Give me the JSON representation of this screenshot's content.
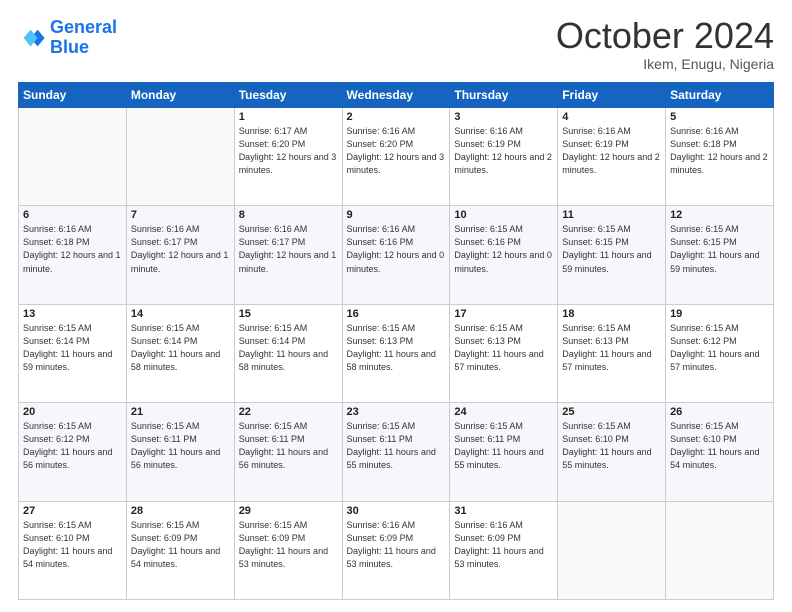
{
  "header": {
    "logo_general": "General",
    "logo_blue": "Blue",
    "month": "October 2024",
    "location": "Ikem, Enugu, Nigeria"
  },
  "days_of_week": [
    "Sunday",
    "Monday",
    "Tuesday",
    "Wednesday",
    "Thursday",
    "Friday",
    "Saturday"
  ],
  "weeks": [
    [
      {
        "day": "",
        "info": ""
      },
      {
        "day": "",
        "info": ""
      },
      {
        "day": "1",
        "info": "Sunrise: 6:17 AM\nSunset: 6:20 PM\nDaylight: 12 hours and 3 minutes."
      },
      {
        "day": "2",
        "info": "Sunrise: 6:16 AM\nSunset: 6:20 PM\nDaylight: 12 hours and 3 minutes."
      },
      {
        "day": "3",
        "info": "Sunrise: 6:16 AM\nSunset: 6:19 PM\nDaylight: 12 hours and 2 minutes."
      },
      {
        "day": "4",
        "info": "Sunrise: 6:16 AM\nSunset: 6:19 PM\nDaylight: 12 hours and 2 minutes."
      },
      {
        "day": "5",
        "info": "Sunrise: 6:16 AM\nSunset: 6:18 PM\nDaylight: 12 hours and 2 minutes."
      }
    ],
    [
      {
        "day": "6",
        "info": "Sunrise: 6:16 AM\nSunset: 6:18 PM\nDaylight: 12 hours and 1 minute."
      },
      {
        "day": "7",
        "info": "Sunrise: 6:16 AM\nSunset: 6:17 PM\nDaylight: 12 hours and 1 minute."
      },
      {
        "day": "8",
        "info": "Sunrise: 6:16 AM\nSunset: 6:17 PM\nDaylight: 12 hours and 1 minute."
      },
      {
        "day": "9",
        "info": "Sunrise: 6:16 AM\nSunset: 6:16 PM\nDaylight: 12 hours and 0 minutes."
      },
      {
        "day": "10",
        "info": "Sunrise: 6:15 AM\nSunset: 6:16 PM\nDaylight: 12 hours and 0 minutes."
      },
      {
        "day": "11",
        "info": "Sunrise: 6:15 AM\nSunset: 6:15 PM\nDaylight: 11 hours and 59 minutes."
      },
      {
        "day": "12",
        "info": "Sunrise: 6:15 AM\nSunset: 6:15 PM\nDaylight: 11 hours and 59 minutes."
      }
    ],
    [
      {
        "day": "13",
        "info": "Sunrise: 6:15 AM\nSunset: 6:14 PM\nDaylight: 11 hours and 59 minutes."
      },
      {
        "day": "14",
        "info": "Sunrise: 6:15 AM\nSunset: 6:14 PM\nDaylight: 11 hours and 58 minutes."
      },
      {
        "day": "15",
        "info": "Sunrise: 6:15 AM\nSunset: 6:14 PM\nDaylight: 11 hours and 58 minutes."
      },
      {
        "day": "16",
        "info": "Sunrise: 6:15 AM\nSunset: 6:13 PM\nDaylight: 11 hours and 58 minutes."
      },
      {
        "day": "17",
        "info": "Sunrise: 6:15 AM\nSunset: 6:13 PM\nDaylight: 11 hours and 57 minutes."
      },
      {
        "day": "18",
        "info": "Sunrise: 6:15 AM\nSunset: 6:13 PM\nDaylight: 11 hours and 57 minutes."
      },
      {
        "day": "19",
        "info": "Sunrise: 6:15 AM\nSunset: 6:12 PM\nDaylight: 11 hours and 57 minutes."
      }
    ],
    [
      {
        "day": "20",
        "info": "Sunrise: 6:15 AM\nSunset: 6:12 PM\nDaylight: 11 hours and 56 minutes."
      },
      {
        "day": "21",
        "info": "Sunrise: 6:15 AM\nSunset: 6:11 PM\nDaylight: 11 hours and 56 minutes."
      },
      {
        "day": "22",
        "info": "Sunrise: 6:15 AM\nSunset: 6:11 PM\nDaylight: 11 hours and 56 minutes."
      },
      {
        "day": "23",
        "info": "Sunrise: 6:15 AM\nSunset: 6:11 PM\nDaylight: 11 hours and 55 minutes."
      },
      {
        "day": "24",
        "info": "Sunrise: 6:15 AM\nSunset: 6:11 PM\nDaylight: 11 hours and 55 minutes."
      },
      {
        "day": "25",
        "info": "Sunrise: 6:15 AM\nSunset: 6:10 PM\nDaylight: 11 hours and 55 minutes."
      },
      {
        "day": "26",
        "info": "Sunrise: 6:15 AM\nSunset: 6:10 PM\nDaylight: 11 hours and 54 minutes."
      }
    ],
    [
      {
        "day": "27",
        "info": "Sunrise: 6:15 AM\nSunset: 6:10 PM\nDaylight: 11 hours and 54 minutes."
      },
      {
        "day": "28",
        "info": "Sunrise: 6:15 AM\nSunset: 6:09 PM\nDaylight: 11 hours and 54 minutes."
      },
      {
        "day": "29",
        "info": "Sunrise: 6:15 AM\nSunset: 6:09 PM\nDaylight: 11 hours and 53 minutes."
      },
      {
        "day": "30",
        "info": "Sunrise: 6:16 AM\nSunset: 6:09 PM\nDaylight: 11 hours and 53 minutes."
      },
      {
        "day": "31",
        "info": "Sunrise: 6:16 AM\nSunset: 6:09 PM\nDaylight: 11 hours and 53 minutes."
      },
      {
        "day": "",
        "info": ""
      },
      {
        "day": "",
        "info": ""
      }
    ]
  ]
}
